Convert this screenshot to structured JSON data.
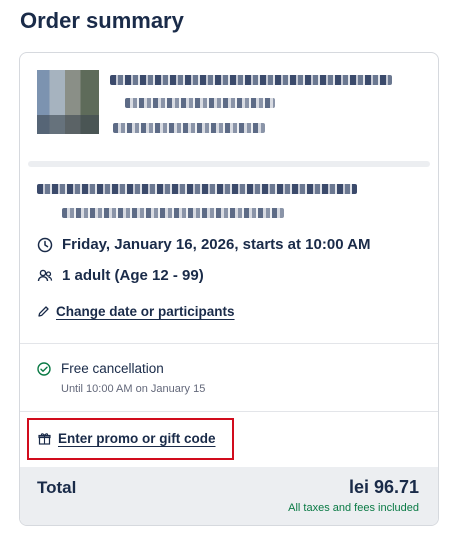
{
  "header": {
    "title": "Order summary"
  },
  "booking": {
    "date_time": "Friday, January 16, 2026, starts at 10:00 AM",
    "participants": "1 adult (Age 12 - 99)",
    "change_link": "Change date or participants"
  },
  "cancellation": {
    "title": "Free cancellation",
    "until": "Until 10:00 AM on January 15"
  },
  "promo": {
    "link": "Enter promo or gift code"
  },
  "total": {
    "label": "Total",
    "amount": "lei 96.71",
    "taxes_note": "All taxes and fees included"
  },
  "colors": {
    "text": "#1a2b49",
    "success": "#0a7a45",
    "highlight": "#d10c1d"
  },
  "icons": [
    "clock-icon",
    "people-icon",
    "pencil-icon",
    "check-circle-icon",
    "gift-icon"
  ]
}
